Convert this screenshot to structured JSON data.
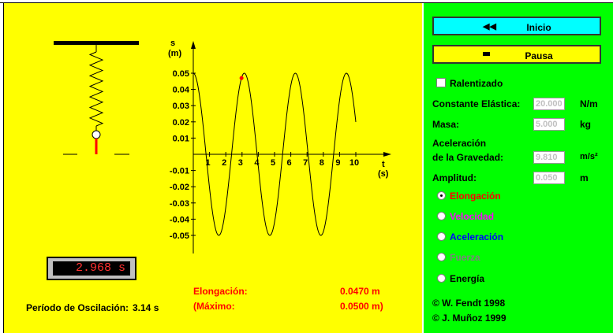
{
  "simulation": {
    "graph": {
      "y_axis_label": "s",
      "y_axis_unit": "(m)",
      "x_axis_label": "t",
      "x_axis_unit": "(s)",
      "y_ticks": [
        "0.05",
        "0.04",
        "0.03",
        "0.02",
        "0.01",
        "-0.01",
        "-0.02",
        "-0.03",
        "-0.04",
        "-0.05"
      ],
      "x_ticks": [
        "1",
        "2",
        "3",
        "4",
        "5",
        "6",
        "7",
        "8",
        "9",
        "10"
      ]
    },
    "timer_display": "2.968 s",
    "period_label": "Período de Oscilación:",
    "period_value": "3.14 s",
    "elongation_label": "Elongación:",
    "elongation_value": "0.0470 m",
    "max_label": "(Máximo:",
    "max_value": "0.0500 m)"
  },
  "chart_data": {
    "type": "line",
    "series": [
      {
        "function": "0.05*cos(2*pi*t/3.14)",
        "t_range": [
          0,
          10
        ]
      }
    ],
    "current_point": {
      "t": 2.968,
      "s": 0.047
    },
    "xlabel": "t (s)",
    "ylabel": "s (m)",
    "xlim": [
      0,
      10
    ],
    "ylim": [
      -0.05,
      0.05
    ]
  },
  "controls": {
    "reset_icon": "rewind-icon",
    "reset_label": "Inicio",
    "pause_icon": "pause-icon",
    "pause_label": "Pausa",
    "slow_motion_label": "Ralentizado",
    "spring_constant_label": "Constante Elástica:",
    "spring_constant_value": "20.000",
    "spring_constant_unit": "N/m",
    "mass_label": "Masa:",
    "mass_value": "5.000",
    "mass_unit": "kg",
    "gravity_label_line1": "Aceleración",
    "gravity_label_line2": "de la Gravedad:",
    "gravity_value": "9.810",
    "gravity_unit": "m/s²",
    "amplitude_label": "Amplitud:",
    "amplitude_value": "0.050",
    "amplitude_unit": "m",
    "options": [
      {
        "label": "Elongación",
        "color": "#ff0000",
        "selected": true
      },
      {
        "label": "Velocidad",
        "color": "#ff00ff",
        "selected": false
      },
      {
        "label": "Aceleración",
        "color": "#0000ff",
        "selected": false
      },
      {
        "label": "Fuerza",
        "color": "#808080",
        "selected": false
      },
      {
        "label": "Energía",
        "color": "#000000",
        "selected": false
      }
    ],
    "copyright_1": "© W. Fendt 1998",
    "copyright_2": "© J. Muñoz 1999"
  },
  "colors": {
    "sim_background": "#ffff00",
    "panel_background": "#00ff00",
    "reset_button": "#00ffff",
    "pause_button": "#ffff00",
    "curve": "#000000",
    "point": "#ff0000",
    "info_red": "#ff0000"
  }
}
